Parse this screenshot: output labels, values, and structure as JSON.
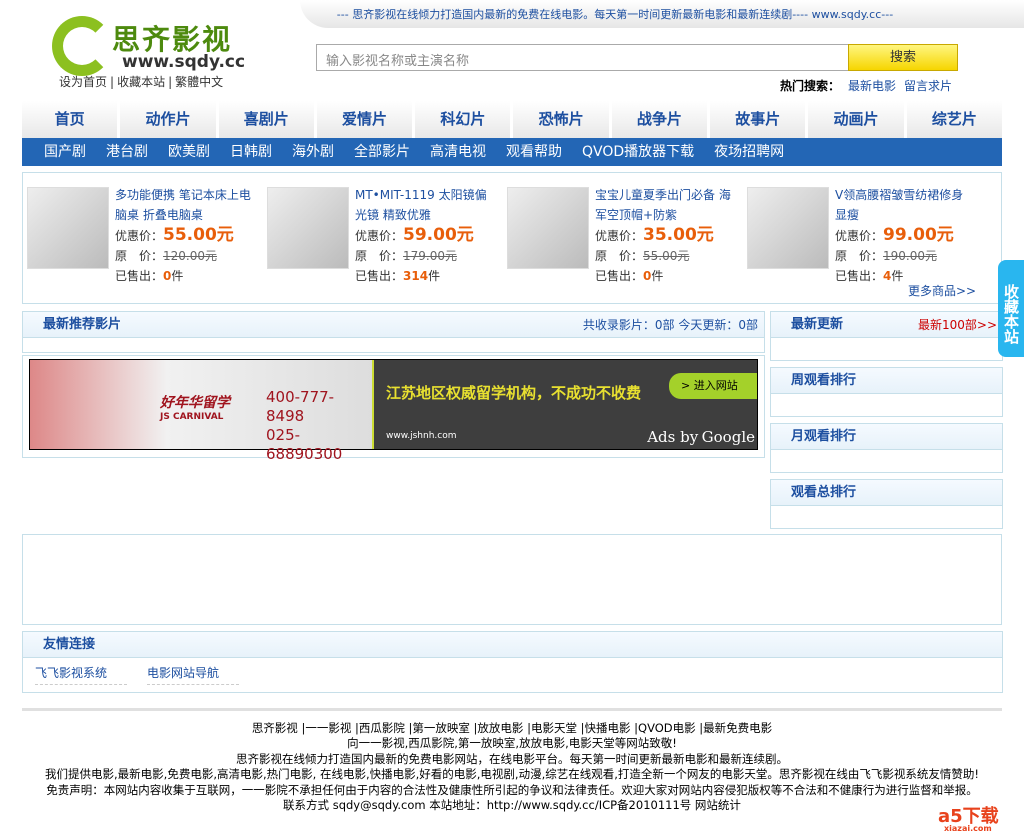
{
  "header": {
    "slogan": "--- 思齐影视在线倾力打造国内最新的免费在线电影。每天第一时间更新最新电影和最新连续剧---- www.sqdy.cc---",
    "logo_text": "思齐影视",
    "logo_url": "www.sqdy.cc",
    "top_links": [
      "设为首页",
      "收藏本站",
      "繁體中文"
    ],
    "search_placeholder": "输入影视名称或主演名称",
    "search_button": "搜索",
    "hot_label": "热门搜索：",
    "hot_links": [
      "最新电影",
      "留言求片"
    ]
  },
  "nav": [
    "首页",
    "动作片",
    "喜剧片",
    "爱情片",
    "科幻片",
    "恐怖片",
    "战争片",
    "故事片",
    "动画片",
    "综艺片"
  ],
  "subnav": [
    "国产剧",
    "港台剧",
    "欧美剧",
    "日韩剧",
    "海外剧",
    "全部影片",
    "高清电视",
    "观看帮助",
    "QVOD播放器下载",
    "夜场招聘网"
  ],
  "products": {
    "price_label": "优惠价：",
    "orig_label": "原　价：",
    "sold_label": "已售出：",
    "unit": "件",
    "more": "更多商品>>",
    "items": [
      {
        "title": "多功能便携 笔记本床上电脑桌 折叠电脑桌",
        "price": "55.00元",
        "orig": "120.00元",
        "sold": "0"
      },
      {
        "title": "MT•MIT-1119 太阳镜偏光镜 精致优雅",
        "price": "59.00元",
        "orig": "179.00元",
        "sold": "314"
      },
      {
        "title": "宝宝儿童夏季出门必备 海军空顶帽+防紫",
        "price": "35.00元",
        "orig": "55.00元",
        "sold": "0"
      },
      {
        "title": "V领高腰褶皱雪纺裙修身显瘦",
        "price": "99.00元",
        "orig": "190.00元",
        "sold": "4"
      }
    ]
  },
  "recommend": {
    "title": "最新推荐影片",
    "stats": "共收录影片：0部 今天更新：0部"
  },
  "ad": {
    "brand": "好年华留学",
    "brand_en": "JS CARNIVAL",
    "phone1": "400-777-8498",
    "phone2": "025-68890300",
    "message": "江苏地区权威留学机构，不成功不收费",
    "button": "进入网站",
    "site": "www.jshnh.com",
    "ads_by": "Ads by",
    "google": "Google"
  },
  "right": {
    "latest": "最新更新",
    "latest_link": "最新100部>>",
    "weekly": "周观看排行",
    "monthly": "月观看排行",
    "total": "观看总排行"
  },
  "friends": {
    "title": "友情连接",
    "items": [
      "飞飞影视系统",
      "电影网站导航"
    ]
  },
  "footer": {
    "lines": [
      "思齐影视 |一一影视 |西瓜影院 |第一放映室 |放放电影 |电影天堂 |快播电影 |QVOD电影 |最新免费电影",
      "向一一影视,西瓜影院,第一放映室,放放电影,电影天堂等网站致敬!",
      "思齐影视在线倾力打造国内最新的免费电影网站，在线电影平台。每天第一时间更新最新电影和最新连续剧。",
      "我们提供电影,最新电影,免费电影,高清电影,热门电影, 在线电影,快播电影,好看的电影,电视剧,动漫,综艺在线观看,打造全新一个网友的电影天堂。思齐影视在线由飞飞影视系统友情赞助!",
      "免责声明：本网站内容收集于互联网，一一影院不承担任何由于内容的合法性及健康性所引起的争议和法律责任。欢迎大家对网站内容侵犯版权等不合法和不健康行为进行监督和举报。",
      "联系方式 sqdy@sqdy.com 本站地址：http://www.sqdy.cc/ICP备2010111号 网站统计"
    ]
  },
  "side_tab": "收藏本站",
  "watermark": {
    "brand": "a5下载",
    "sub": "xiazai.com"
  }
}
